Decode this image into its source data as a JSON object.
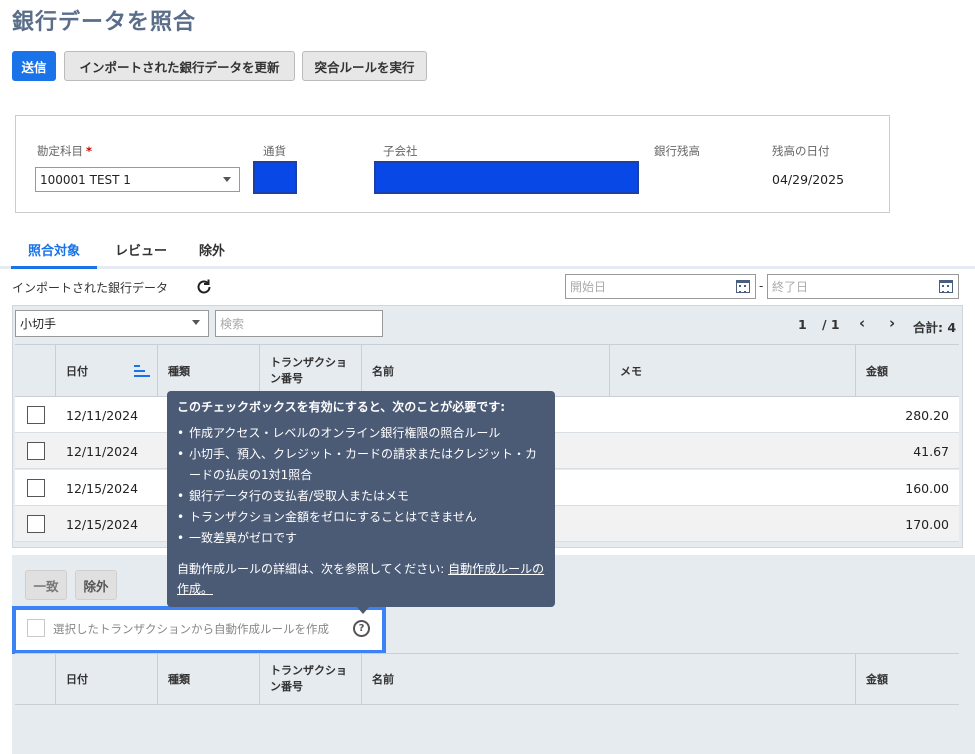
{
  "page": {
    "title": "銀行データを照合"
  },
  "toolbar": {
    "submit": "送信",
    "refresh_imported": "インポートされた銀行データを更新",
    "run_rules": "突合ルールを実行"
  },
  "filters": {
    "account_label": "勘定科目",
    "account_required_mark": "*",
    "account_value": "100001 TEST 1",
    "currency_label": "通貨",
    "subsidiary_label": "子会社",
    "bank_balance_label": "銀行残高",
    "balance_date_label": "残高の日付",
    "balance_date_value": "04/29/2025"
  },
  "tabs": [
    {
      "label": "照合対象",
      "active": true
    },
    {
      "label": "レビュー",
      "active": false
    },
    {
      "label": "除外",
      "active": false
    }
  ],
  "imported": {
    "label": "インポートされた銀行データ",
    "start_placeholder": "開始日",
    "end_placeholder": "終了日",
    "separator": "-"
  },
  "grid_toolbar": {
    "type_select": "小切手",
    "search_placeholder": "検索",
    "page_current": "1",
    "page_total": "/ 1",
    "total": "合計: 4"
  },
  "columns": {
    "date": "日付",
    "type": "種類",
    "txn_no_1": "トランザクショ",
    "txn_no_2": "ン番号",
    "name": "名前",
    "memo": "メモ",
    "amount": "金額"
  },
  "rows": [
    {
      "date": "12/11/2024",
      "amount": "280.20"
    },
    {
      "date": "12/11/2024",
      "amount": "41.67"
    },
    {
      "date": "12/15/2024",
      "amount": "160.00"
    },
    {
      "date": "12/15/2024",
      "amount": "170.00"
    }
  ],
  "lower": {
    "match": "一致",
    "exclude": "除外",
    "auto_rule_checkbox": "選択したトランザクションから自動作成ルールを作成"
  },
  "tooltip": {
    "heading": "このチェックボックスを有効にすると、次のことが必要です:",
    "items": [
      "作成アクセス・レベルのオンライン銀行権限の照合ルール",
      "小切手、預入、クレジット・カードの請求またはクレジット・カードの払戻の1対1照合",
      "銀行データ行の支払者/受取人またはメモ",
      "トランザクション金額をゼロにすることはできません",
      "一致差異がゼロです"
    ],
    "footer_text": "自動作成ルールの詳細は、次を参照してください: ",
    "footer_link": "自動作成ルールの作成。"
  },
  "colors": {
    "primary": "#1a73e8",
    "redaction": "#0748e6",
    "tooltip_bg": "#4b5a75",
    "highlight": "#3b82f6"
  }
}
